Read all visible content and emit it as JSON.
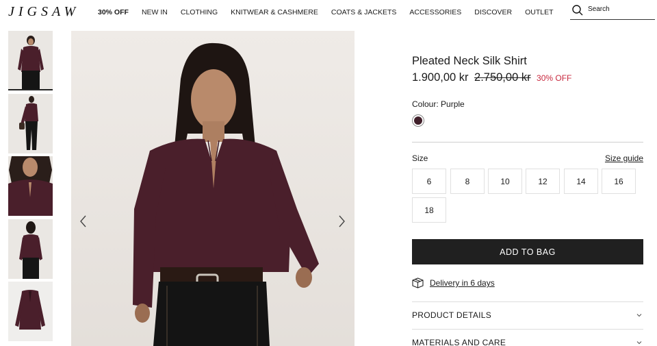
{
  "header": {
    "logo": "JIGSAW",
    "nav": [
      {
        "label": "30% OFF",
        "bold": true
      },
      {
        "label": "NEW IN"
      },
      {
        "label": "CLOTHING"
      },
      {
        "label": "KNITWEAR & CASHMERE"
      },
      {
        "label": "COATS & JACKETS"
      },
      {
        "label": "ACCESSORIES"
      },
      {
        "label": "DISCOVER"
      },
      {
        "label": "OUTLET"
      }
    ],
    "search": {
      "placeholder": "Search",
      "icon": "search-icon"
    }
  },
  "gallery": {
    "thumbnails": [
      "front-view",
      "full-length-view",
      "detail-view",
      "back-view",
      "flat-lay-view"
    ],
    "active_index": 0,
    "prev_icon": "chevron-left-icon",
    "next_icon": "chevron-right-icon"
  },
  "product": {
    "title": "Pleated Neck Silk Shirt",
    "price": "1.900,00 kr",
    "old_price": "2.750,00 kr",
    "discount": "30% OFF",
    "colour_label": "Colour: Purple",
    "swatch_color": "#41202b",
    "size_label": "Size",
    "size_guide": "Size guide",
    "sizes": [
      "6",
      "8",
      "10",
      "12",
      "14",
      "16",
      "18"
    ],
    "add_to_bag": "ADD TO BAG",
    "delivery": "Delivery in 6 days",
    "delivery_icon": "box-icon",
    "accordions": [
      {
        "label": "PRODUCT DETAILS",
        "icon": "chevron-down-icon"
      },
      {
        "label": "MATERIALS AND CARE",
        "icon": "chevron-down-icon"
      }
    ]
  },
  "colors": {
    "garment": "#4a1f2b",
    "accent_sale": "#c8283e",
    "button_bg": "#202020"
  }
}
